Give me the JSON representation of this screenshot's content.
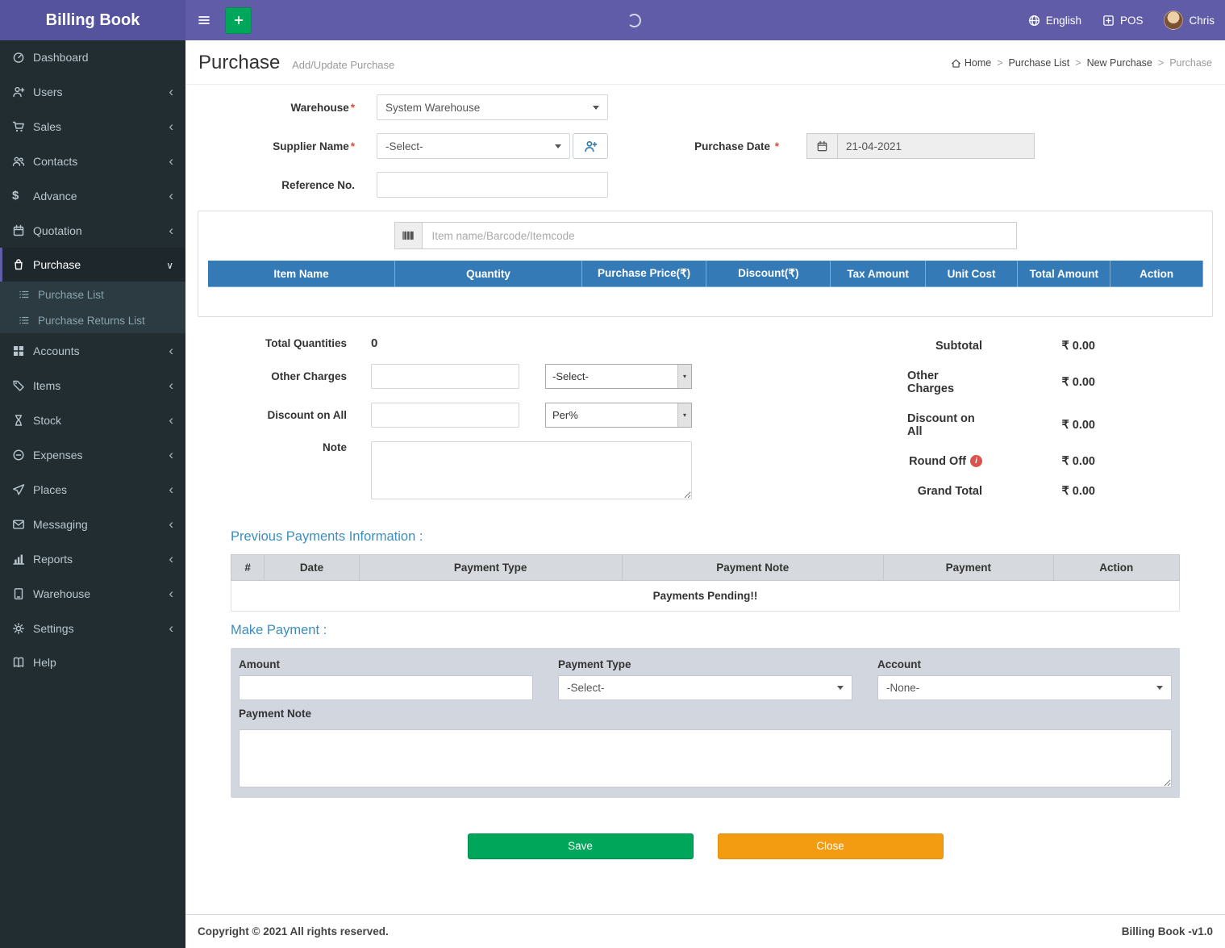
{
  "app": {
    "name": "Billing Book"
  },
  "navbar": {
    "language_label": "English",
    "pos_label": "POS",
    "user_name": "Chris",
    "icons": [
      "hamburger-icon",
      "plus-icon",
      "loading-spinner",
      "globe-icon",
      "pos-plus-square-icon",
      "user-avatar"
    ]
  },
  "sidebar": {
    "items": [
      {
        "label": "Dashboard",
        "icon": "dashboard-icon",
        "expandable": false
      },
      {
        "label": "Users",
        "icon": "users-icon",
        "expandable": true
      },
      {
        "label": "Sales",
        "icon": "sales-cart-icon",
        "expandable": true
      },
      {
        "label": "Contacts",
        "icon": "contacts-icon",
        "expandable": true
      },
      {
        "label": "Advance",
        "icon": "dollar-icon",
        "expandable": true
      },
      {
        "label": "Quotation",
        "icon": "quotation-calendar-icon",
        "expandable": true
      },
      {
        "label": "Purchase",
        "icon": "purchase-bag-icon",
        "expandable": true,
        "active": true,
        "expanded": true
      },
      {
        "label": "Accounts",
        "icon": "accounts-grid-icon",
        "expandable": true
      },
      {
        "label": "Items",
        "icon": "items-tag-icon",
        "expandable": true
      },
      {
        "label": "Stock",
        "icon": "stock-hourglass-icon",
        "expandable": true
      },
      {
        "label": "Expenses",
        "icon": "expenses-minus-circle-icon",
        "expandable": true
      },
      {
        "label": "Places",
        "icon": "places-send-icon",
        "expandable": true
      },
      {
        "label": "Messaging",
        "icon": "messaging-envelope-icon",
        "expandable": true
      },
      {
        "label": "Reports",
        "icon": "reports-chart-icon",
        "expandable": true
      },
      {
        "label": "Warehouse",
        "icon": "warehouse-icon",
        "expandable": true
      },
      {
        "label": "Settings",
        "icon": "settings-gear-icon",
        "expandable": true
      },
      {
        "label": "Help",
        "icon": "help-book-icon",
        "expandable": false
      }
    ],
    "purchase_submenu": [
      {
        "label": "Purchase List",
        "icon": "list-icon"
      },
      {
        "label": "Purchase Returns List",
        "icon": "list-icon"
      }
    ]
  },
  "page": {
    "title": "Purchase",
    "subtitle": "Add/Update Purchase",
    "breadcrumb": [
      "Home",
      "Purchase List",
      "New Purchase",
      "Purchase"
    ]
  },
  "form": {
    "required_mark": "*",
    "warehouse": {
      "label": "Warehouse",
      "value": "System Warehouse"
    },
    "supplier": {
      "label": "Supplier Name",
      "value": "-Select-"
    },
    "purchase_date": {
      "label": "Purchase Date",
      "value": "21-04-2021"
    },
    "reference": {
      "label": "Reference No."
    },
    "item_search_placeholder": "Item name/Barcode/Itemcode"
  },
  "items_table": {
    "columns": [
      "Item Name",
      "Quantity",
      "Purchase Price(₹)",
      "Discount(₹)",
      "Tax Amount",
      "Unit Cost",
      "Total Amount",
      "Action"
    ],
    "rows": []
  },
  "totals": {
    "total_quantities_label": "Total Quantities",
    "total_quantities_value": "0",
    "other_charges_label": "Other Charges",
    "other_charges_select": "-Select-",
    "discount_on_all_label": "Discount on All",
    "discount_on_all_select": "Per%",
    "note_label": "Note"
  },
  "summary": {
    "rows": [
      {
        "label": "Subtotal",
        "value": "₹ 0.00"
      },
      {
        "label": "Other Charges",
        "value": "₹ 0.00"
      },
      {
        "label": "Discount on All",
        "value": "₹ 0.00"
      },
      {
        "label": "Round Off",
        "value": "₹ 0.00",
        "info": true
      },
      {
        "label": "Grand Total",
        "value": "₹ 0.00"
      }
    ]
  },
  "previous_payments": {
    "title": "Previous Payments Information :",
    "columns": [
      "#",
      "Date",
      "Payment Type",
      "Payment Note",
      "Payment",
      "Action"
    ],
    "empty_message": "Payments Pending!!"
  },
  "make_payment": {
    "title": "Make Payment :",
    "amount_label": "Amount",
    "payment_type_label": "Payment Type",
    "payment_type_value": "-Select-",
    "account_label": "Account",
    "account_value": "-None-",
    "payment_note_label": "Payment Note"
  },
  "actions": {
    "save": "Save",
    "close": "Close"
  },
  "footer": {
    "copyright": "Copyright © 2021 All rights reserved.",
    "version": "Billing Book -v1.0"
  },
  "colors": {
    "navbar": "#605ca8",
    "logo_bg": "#55529e",
    "sidebar": "#222d32",
    "table_header": "#337ab7",
    "save_button": "#00a65a",
    "close_button": "#f39c12",
    "section_title": "#3c8dbc",
    "required": "#dd4b39"
  }
}
